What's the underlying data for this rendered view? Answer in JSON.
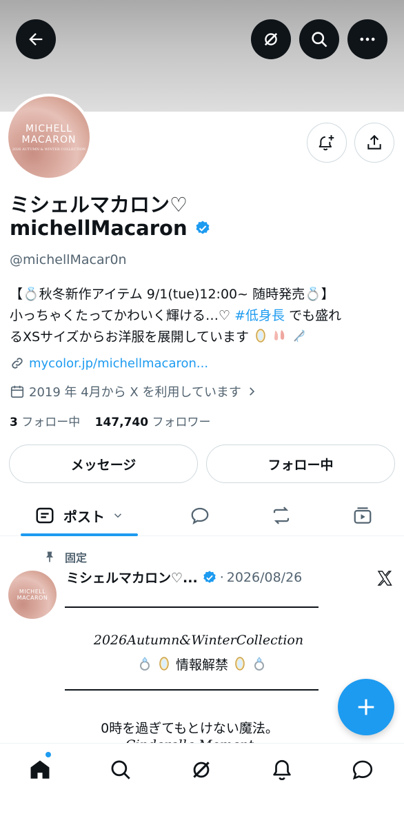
{
  "header": {
    "back_icon": "arrow-left-icon",
    "grok_icon": "grok-icon",
    "search_icon": "search-icon",
    "more_icon": "more-dots-icon"
  },
  "avatar": {
    "brand_line1": "MICHELL",
    "brand_line2": "MACARON",
    "brand_sub": "2026 AUTUMN & WINTER COLLECTION"
  },
  "profile": {
    "name_line1": "ミシェルマカロン♡",
    "name_line2": "michellMacaron",
    "handle": "@michellMacar0n",
    "bio_line1": "【💍秋冬新作アイテム 9/1(tue)12:00~ 随時発売💍】",
    "bio_line2_a": "小っちゃくたってかわいく輝ける…♡ ",
    "bio_hashtag": "#低身長",
    "bio_line2_b": " でも盛れ",
    "bio_line3": "るXSサイズからお洋服を展開しています",
    "link": "mycolor.jp/michellmacaron...",
    "joined": "2019 年 4月から X を利用しています",
    "following_count": "3",
    "following_label": " フォロー中",
    "followers_count": "147,740",
    "followers_label": " フォロワー"
  },
  "actions": {
    "message_label": "メッセージ",
    "following_button_label": "フォロー中"
  },
  "tabs": {
    "posts_label": "ポスト"
  },
  "pinned_post": {
    "pinned_label": "固定",
    "author": "ミシェルマカロン♡...",
    "date": "2026/08/26",
    "collection_line": "2026Autumn&WinterCollection",
    "announce_line": "情報解禁",
    "body_line1": "0時を過ぎてもとけない魔法。",
    "body_line2": "Cinderella Moment"
  },
  "colors": {
    "accent": "#1d9bf0",
    "text": "#0f1419",
    "muted": "#536471"
  }
}
